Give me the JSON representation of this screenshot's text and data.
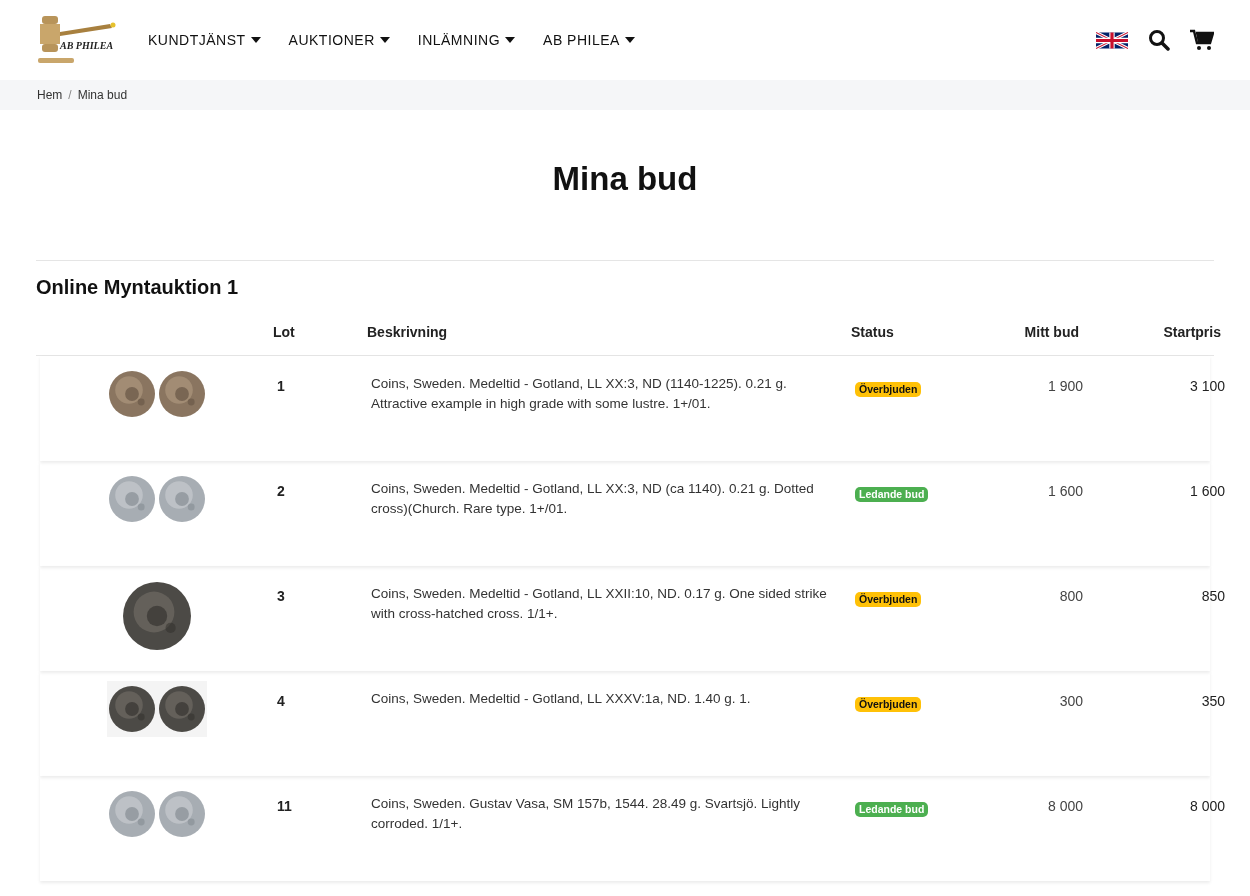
{
  "header": {
    "logo_text": "AB PHILEA",
    "nav": [
      {
        "label": "KUNDTJÄNST"
      },
      {
        "label": "AUKTIONER"
      },
      {
        "label": "INLÄMNING"
      },
      {
        "label": "AB PHILEA"
      }
    ]
  },
  "breadcrumb": {
    "separator": "/",
    "items": [
      "Hem",
      "Mina bud"
    ]
  },
  "page_title": "Mina bud",
  "section": {
    "title": "Online Myntauktion 1",
    "columns": [
      "Lot",
      "Beskrivning",
      "Status",
      "Mitt bud",
      "Startpris"
    ],
    "rows": [
      {
        "lot": "1",
        "description": "Coins, Sweden. Medeltid - Gotland, LL XX:3, ND (1140-1225). 0.21 g. Attractive example in high grade with some lustre. 1+/01.",
        "status": {
          "kind": "outbid",
          "label": "Överbjuden"
        },
        "my_bid": "1 900",
        "start_price": "3 100"
      },
      {
        "lot": "2",
        "description": "Coins, Sweden. Medeltid - Gotland, LL XX:3, ND (ca 1140). 0.21 g. Dotted cross)(Church. Rare type. 1+/01.",
        "status": {
          "kind": "leading",
          "label": "Ledande bud"
        },
        "my_bid": "1 600",
        "start_price": "1 600"
      },
      {
        "lot": "3",
        "description": "Coins, Sweden. Medeltid - Gotland, LL XXII:10, ND. 0.17 g. One sided strike with cross-hatched cross. 1/1+.",
        "status": {
          "kind": "outbid",
          "label": "Överbjuden"
        },
        "my_bid": "800",
        "start_price": "850"
      },
      {
        "lot": "4",
        "description": "Coins, Sweden. Medeltid - Gotland, LL XXXV:1a, ND. 1.40 g. 1.",
        "status": {
          "kind": "outbid",
          "label": "Överbjuden"
        },
        "my_bid": "300",
        "start_price": "350"
      },
      {
        "lot": "11",
        "description": "Coins, Sweden. Gustav Vasa, SM 157b, 1544. 28.49 g. Svartsjö. Lightly corroded. 1/1+.",
        "status": {
          "kind": "leading",
          "label": "Ledande bud"
        },
        "my_bid": "8 000",
        "start_price": "8 000"
      }
    ]
  }
}
